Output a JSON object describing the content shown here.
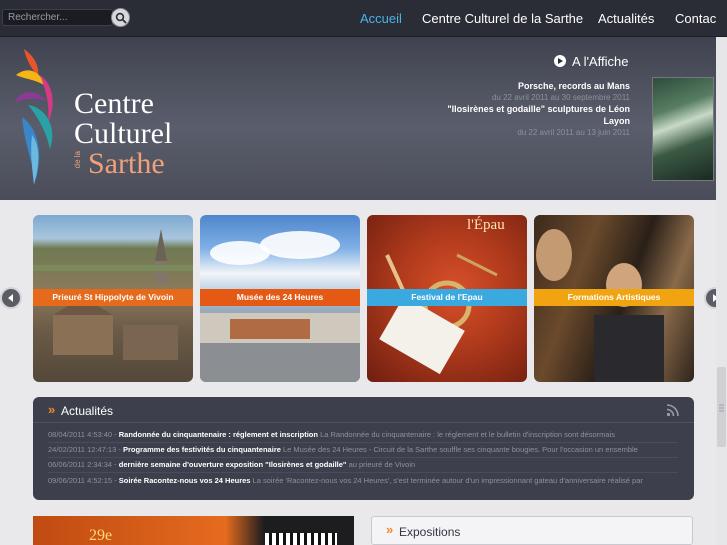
{
  "search": {
    "placeholder": "Rechercher..."
  },
  "nav": [
    {
      "label": "Accueil",
      "active": true
    },
    {
      "label": "Centre Culturel de la Sarthe",
      "active": false
    },
    {
      "label": "Actualités",
      "active": false
    },
    {
      "label": "Contac",
      "active": false
    }
  ],
  "logo": {
    "line1": "Centre",
    "line2": "Culturel",
    "small": "de la",
    "line3": "Sarthe"
  },
  "affiche": {
    "title": "A l'Affiche",
    "items": [
      {
        "title": "Porsche, records au Mans",
        "dates": "du 22 avril 2011 au 30 septembre 2011"
      },
      {
        "title": "\"Ilosirènes et godaille\" sculptures de Léon Layon",
        "dates": "du 22 avril 2011 au 13 juin 2011"
      }
    ]
  },
  "carousel": {
    "cards": [
      {
        "label": "Prieuré St Hippolyte de Vivoin",
        "band_color": "#e56a1c"
      },
      {
        "label": "Musée des 24 Heures",
        "band_color": "#e45a14"
      },
      {
        "label": "Festival de l'Epau",
        "band_color": "#39a9df"
      },
      {
        "label": "Formations Artistiques",
        "band_color": "#f1a411"
      }
    ],
    "card3_title": "l'Épau"
  },
  "news": {
    "title": "Actualités",
    "rows": [
      {
        "date": "08/04/2011 4:53:40",
        "headline": "Randonnée du cinquantenaire : réglement et inscription",
        "excerpt": "La Randonnée du cinquantenaire : le réglement et le bulletin d'inscription sont désormais"
      },
      {
        "date": "24/02/2011 12:47:13",
        "headline": "Programme des festivités du cinquantenaire",
        "excerpt": "Le Musée des 24 Heures - Circuit de la Sarthe souffle ses cinquante bougies. Pour l'occasion un ensemble"
      },
      {
        "date": "06/06/2011 2:34:34",
        "headline": "dernière semaine d'ouverture exposition \"Ilosirènes et godaille\"",
        "excerpt": "au prieuré de Vivoin"
      },
      {
        "date": "09/06/2011 4:52:15",
        "headline": "Soirée Racontez-nous vos 24 Heures",
        "excerpt": "La soirée 'Racontez-nous vos 24 Heures', s'est terminée autour d'un impressionnant gateau d'anniversaire réalisé par"
      }
    ]
  },
  "banner": {
    "number": "29e"
  },
  "expositions": {
    "title": "Expositions"
  },
  "colors": {
    "accent": "#47b4e5",
    "orange": "#f08a24"
  }
}
